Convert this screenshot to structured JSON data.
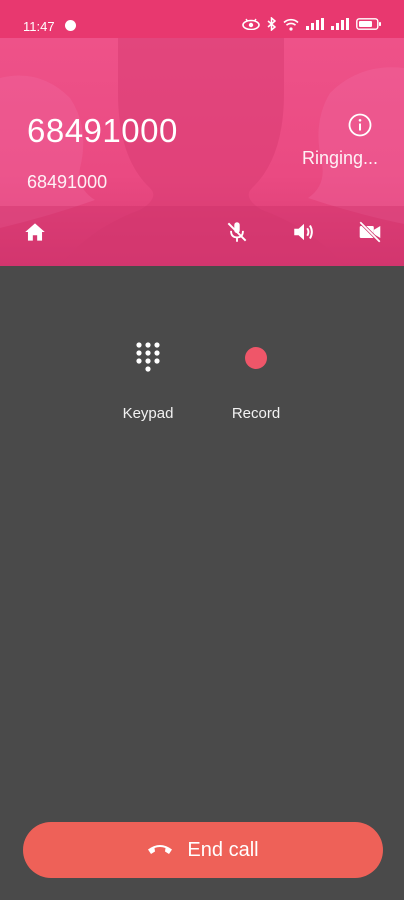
{
  "status_bar": {
    "time": "11:47"
  },
  "call": {
    "number": "68491000",
    "sub_number": "68491000",
    "status": "Ringing..."
  },
  "actions": {
    "keypad_label": "Keypad",
    "record_label": "Record"
  },
  "end_call": {
    "label": "End call"
  },
  "colors": {
    "status_bar": "#e8386f",
    "header": "#ea4a82",
    "background": "#4a4a4a",
    "record_dot": "#ef5669",
    "end_call_button": "#ee6158"
  },
  "icons": {
    "status_bar": [
      "notification-icon",
      "eye-icon",
      "bluetooth-icon",
      "wifi-icon",
      "signal-icon",
      "signal-icon",
      "battery-icon"
    ],
    "header": [
      "info-icon",
      "home-icon",
      "mute-mic-icon",
      "speaker-icon",
      "video-off-icon"
    ],
    "actions": [
      "dialpad-icon",
      "record-icon"
    ],
    "end_call": "phone-hangup-icon"
  }
}
